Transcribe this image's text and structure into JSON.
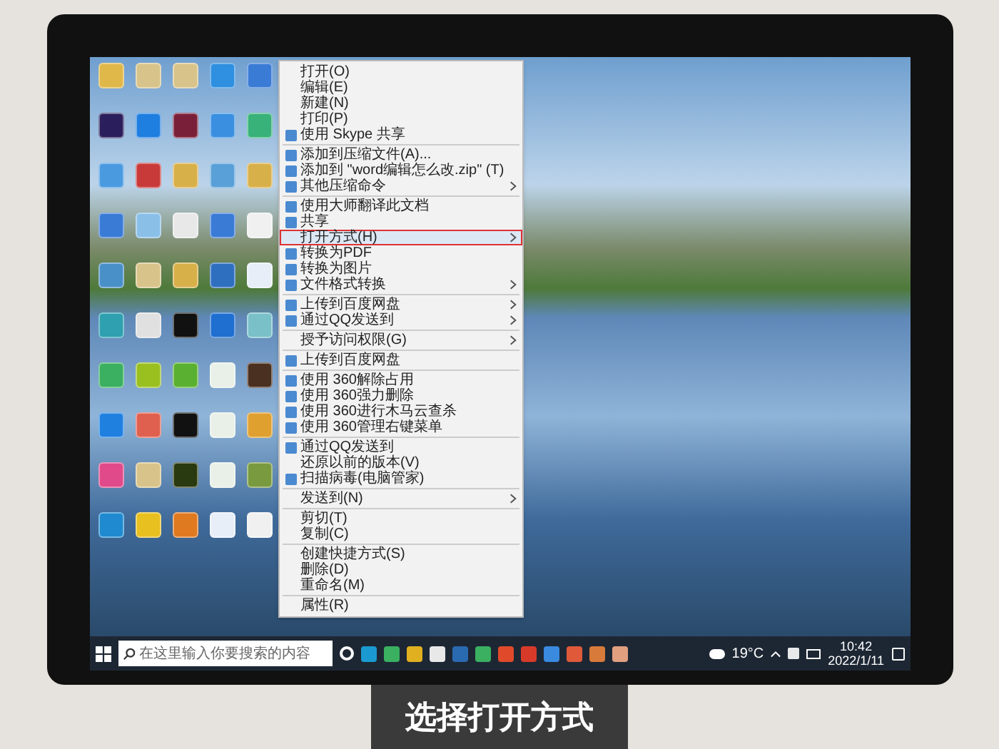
{
  "desktop_icons": [
    {
      "color": "#e0b84a"
    },
    {
      "color": "#d8c48a"
    },
    {
      "color": "#d8c48a"
    },
    {
      "color": "#2f8fe0"
    },
    {
      "color": "#3a7bd5"
    },
    {
      "color": "#2b1e5c"
    },
    {
      "color": "#1f7fe0"
    },
    {
      "color": "#7a1f3a"
    },
    {
      "color": "#3a8fe0"
    },
    {
      "color": "#39b27a"
    },
    {
      "color": "#4a9ae0"
    },
    {
      "color": "#c83a3a"
    },
    {
      "color": "#d8b04a"
    },
    {
      "color": "#5aa0d8"
    },
    {
      "color": "#d8b04a"
    },
    {
      "color": "#3a7bd5"
    },
    {
      "color": "#8ac0e8"
    },
    {
      "color": "#e8e8e8"
    },
    {
      "color": "#3a7bd5"
    },
    {
      "color": "#f0f0f0"
    },
    {
      "color": "#4a90c8"
    },
    {
      "color": "#d8c48a"
    },
    {
      "color": "#d8b04a"
    },
    {
      "color": "#2f6fc0"
    },
    {
      "color": "#e8eef8"
    },
    {
      "color": "#2fa0b0"
    },
    {
      "color": "#e0e0e0"
    },
    {
      "color": "#111111"
    },
    {
      "color": "#1f6fd0"
    },
    {
      "color": "#7ac0c8"
    },
    {
      "color": "#3ab060"
    },
    {
      "color": "#9ac020"
    },
    {
      "color": "#5ab030"
    },
    {
      "color": "#e8f0e8"
    },
    {
      "color": "#4a3020"
    },
    {
      "color": "#1f80e0"
    },
    {
      "color": "#e06050"
    },
    {
      "color": "#111111"
    },
    {
      "color": "#e8f0e8"
    },
    {
      "color": "#e0a030"
    },
    {
      "color": "#e04a8a"
    },
    {
      "color": "#d8c48a"
    },
    {
      "color": "#2a3a10"
    },
    {
      "color": "#e8f0e8"
    },
    {
      "color": "#7a9a40"
    },
    {
      "color": "#1f8ad0"
    },
    {
      "color": "#e8c020"
    },
    {
      "color": "#e07a20"
    },
    {
      "color": "#e8eef8"
    },
    {
      "color": "#f0f0f0"
    }
  ],
  "context_menu": {
    "items": [
      {
        "kind": "item",
        "label": "打开(O)",
        "icon": false,
        "submenu": false,
        "selected": false
      },
      {
        "kind": "item",
        "label": "编辑(E)",
        "icon": false,
        "submenu": false,
        "selected": false
      },
      {
        "kind": "item",
        "label": "新建(N)",
        "icon": false,
        "submenu": false,
        "selected": false
      },
      {
        "kind": "item",
        "label": "打印(P)",
        "icon": false,
        "submenu": false,
        "selected": false
      },
      {
        "kind": "item",
        "label": "使用 Skype 共享",
        "icon": true,
        "submenu": false,
        "selected": false
      },
      {
        "kind": "separator"
      },
      {
        "kind": "item",
        "label": "添加到压缩文件(A)...",
        "icon": true,
        "submenu": false,
        "selected": false
      },
      {
        "kind": "item",
        "label": "添加到 \"word编辑怎么改.zip\" (T)",
        "icon": true,
        "submenu": false,
        "selected": false
      },
      {
        "kind": "item",
        "label": "其他压缩命令",
        "icon": true,
        "submenu": true,
        "selected": false
      },
      {
        "kind": "separator"
      },
      {
        "kind": "item",
        "label": "使用大师翻译此文档",
        "icon": true,
        "submenu": false,
        "selected": false
      },
      {
        "kind": "item",
        "label": "共享",
        "icon": true,
        "submenu": false,
        "selected": false
      },
      {
        "kind": "item",
        "label": "打开方式(H)",
        "icon": false,
        "submenu": true,
        "selected": true
      },
      {
        "kind": "item",
        "label": "转换为PDF",
        "icon": true,
        "submenu": false,
        "selected": false
      },
      {
        "kind": "item",
        "label": "转换为图片",
        "icon": true,
        "submenu": false,
        "selected": false
      },
      {
        "kind": "item",
        "label": "文件格式转换",
        "icon": true,
        "submenu": true,
        "selected": false
      },
      {
        "kind": "separator"
      },
      {
        "kind": "item",
        "label": "上传到百度网盘",
        "icon": true,
        "submenu": true,
        "selected": false
      },
      {
        "kind": "item",
        "label": "通过QQ发送到",
        "icon": true,
        "submenu": true,
        "selected": false
      },
      {
        "kind": "separator"
      },
      {
        "kind": "item",
        "label": "授予访问权限(G)",
        "icon": false,
        "submenu": true,
        "selected": false
      },
      {
        "kind": "separator"
      },
      {
        "kind": "item",
        "label": "上传到百度网盘",
        "icon": true,
        "submenu": false,
        "selected": false
      },
      {
        "kind": "separator"
      },
      {
        "kind": "item",
        "label": "使用 360解除占用",
        "icon": true,
        "submenu": false,
        "selected": false
      },
      {
        "kind": "item",
        "label": "使用 360强力删除",
        "icon": true,
        "submenu": false,
        "selected": false
      },
      {
        "kind": "item",
        "label": "使用 360进行木马云查杀",
        "icon": true,
        "submenu": false,
        "selected": false
      },
      {
        "kind": "item",
        "label": "使用 360管理右键菜单",
        "icon": true,
        "submenu": false,
        "selected": false
      },
      {
        "kind": "separator"
      },
      {
        "kind": "item",
        "label": "通过QQ发送到",
        "icon": true,
        "submenu": false,
        "selected": false
      },
      {
        "kind": "item",
        "label": "还原以前的版本(V)",
        "icon": false,
        "submenu": false,
        "selected": false
      },
      {
        "kind": "item",
        "label": "扫描病毒(电脑管家)",
        "icon": true,
        "submenu": false,
        "selected": false
      },
      {
        "kind": "separator"
      },
      {
        "kind": "item",
        "label": "发送到(N)",
        "icon": false,
        "submenu": true,
        "selected": false
      },
      {
        "kind": "separator"
      },
      {
        "kind": "item",
        "label": "剪切(T)",
        "icon": false,
        "submenu": false,
        "selected": false
      },
      {
        "kind": "item",
        "label": "复制(C)",
        "icon": false,
        "submenu": false,
        "selected": false
      },
      {
        "kind": "separator"
      },
      {
        "kind": "item",
        "label": "创建快捷方式(S)",
        "icon": false,
        "submenu": false,
        "selected": false
      },
      {
        "kind": "item",
        "label": "删除(D)",
        "icon": false,
        "submenu": false,
        "selected": false
      },
      {
        "kind": "item",
        "label": "重命名(M)",
        "icon": false,
        "submenu": false,
        "selected": false
      },
      {
        "kind": "separator"
      },
      {
        "kind": "item",
        "label": "属性(R)",
        "icon": false,
        "submenu": false,
        "selected": false
      }
    ]
  },
  "taskbar": {
    "search": {
      "placeholder": "在这里输入你要搜索的内容"
    },
    "pinned_apps": [
      {
        "color": "#1a9ad0"
      },
      {
        "color": "#3ab060"
      },
      {
        "color": "#e0b020"
      },
      {
        "color": "#e8e8e8"
      },
      {
        "color": "#2a6ab0"
      },
      {
        "color": "#3ab060"
      },
      {
        "color": "#e04a2a"
      },
      {
        "color": "#d83a2a"
      },
      {
        "color": "#3a8ae0"
      },
      {
        "color": "#e05a3a"
      },
      {
        "color": "#d87a3a"
      },
      {
        "color": "#e0a080"
      }
    ],
    "weather": "19°C",
    "time": "10:42",
    "date": "2022/1/11"
  },
  "caption": "选择打开方式"
}
